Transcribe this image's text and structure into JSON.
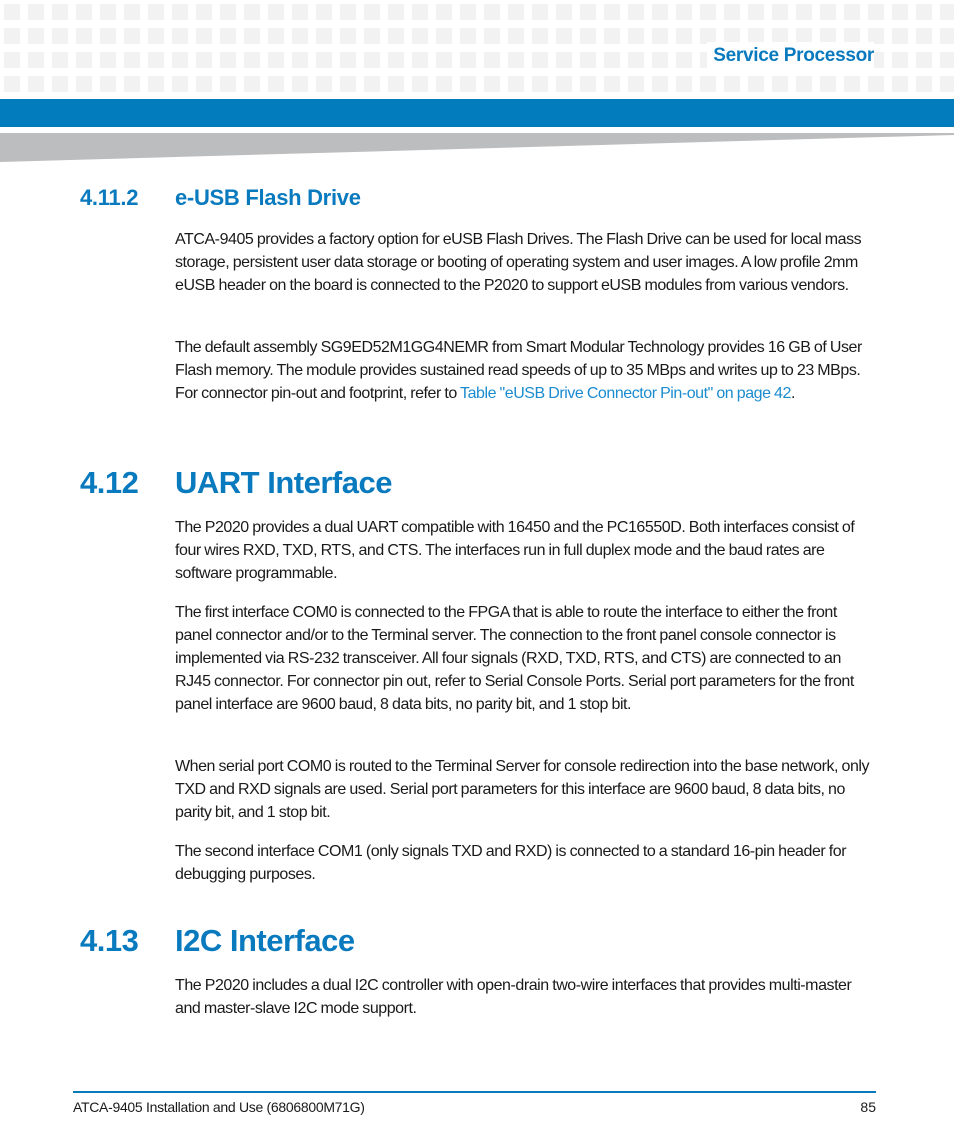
{
  "header": {
    "running_title": "Service Processor",
    "accent_color": "#027cbd"
  },
  "sections": [
    {
      "number": "4.11.2",
      "title": "e-USB Flash Drive",
      "paragraphs": [
        "ATCA-9405 provides a factory option for eUSB Flash Drives. The Flash Drive can be used for local mass storage, persistent user data storage or booting of operating system and user images. A low profile 2mm eUSB header on the board is connected to the P2020 to support eUSB modules from various vendors.",
        {
          "before": "The default assembly SG9ED52M1GG4NEMR from Smart Modular Technology provides 16 GB of User Flash memory. The module provides sustained read speeds of up to 35 MBps and writes up to 23 MBps. For connector pin-out and footprint, refer to ",
          "link": "Table \"eUSB Drive Connector Pin-out\" on page 42",
          "after": "."
        }
      ]
    },
    {
      "number": "4.12",
      "title": "UART Interface",
      "paragraphs": [
        "The P2020 provides a dual UART compatible with 16450 and the PC16550D. Both interfaces consist of four wires RXD, TXD, RTS, and CTS. The interfaces run in full duplex mode and the baud rates are software programmable.",
        "The first interface COM0 is connected to the FPGA that is able to route the interface to either the front panel connector and/or to the Terminal server. The connection to the front panel console connector is implemented via RS-232 transceiver. All four signals (RXD, TXD, RTS, and CTS) are connected to an RJ45 connector. For connector pin out, refer to Serial Console Ports. Serial port parameters for the front panel interface are 9600 baud, 8 data bits, no parity bit, and 1 stop bit.",
        "When serial port COM0 is routed to the Terminal Server for console redirection into the base network, only TXD and RXD signals are used. Serial port parameters for this interface are 9600 baud, 8 data bits, no parity bit, and 1 stop bit.",
        "The second interface COM1 (only signals TXD and RXD) is connected to a standard 16-pin header for debugging purposes."
      ]
    },
    {
      "number": "4.13",
      "title": "I2C Interface",
      "paragraphs": [
        "The P2020 includes a dual I2C controller with open-drain two-wire interfaces that provides multi-master and master-slave I2C mode support."
      ]
    }
  ],
  "footer": {
    "document_title": "ATCA-9405 Installation and Use (6806800M71G)",
    "page_number": "85"
  }
}
